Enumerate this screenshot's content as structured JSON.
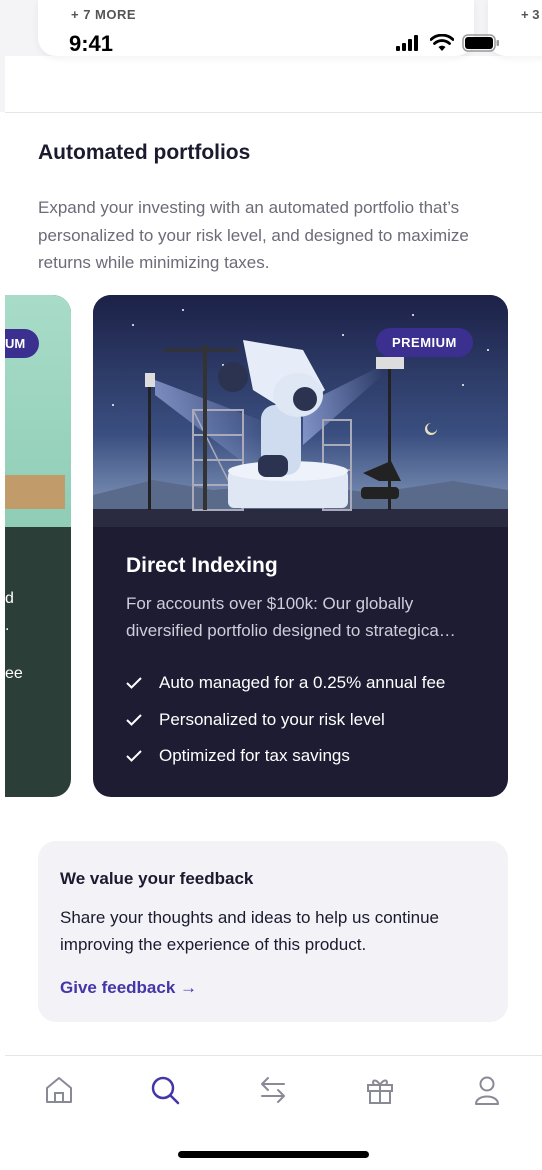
{
  "top_cards": {
    "more_label_1": "+ 7 MORE",
    "more_label_2": "+ 3"
  },
  "status_bar": {
    "time": "9:41"
  },
  "section": {
    "title": "Automated portfolios",
    "description": "Expand your investing with an automated portfolio that’s personalized to your risk level, and designed to maximize returns while minimizing taxes."
  },
  "carousel": {
    "left_card": {
      "badge_partial": "UM",
      "text_fragments": [
        "d",
        ".",
        "ee"
      ]
    },
    "main_card": {
      "badge": "PREMIUM",
      "title": "Direct Indexing",
      "description": "For accounts over $100k: Our globally diversified portfolio designed to strategica…",
      "features": [
        "Auto managed for a 0.25% annual fee",
        "Personalized to your risk level",
        "Optimized for tax savings"
      ]
    }
  },
  "feedback": {
    "title": "We value your feedback",
    "body": "Share your thoughts and ideas to help us continue improving the experience of this product.",
    "link": "Give feedback →"
  },
  "tabbar": {
    "items": [
      "home-icon",
      "search-icon",
      "transfer-icon",
      "gift-icon",
      "profile-icon"
    ],
    "active": "search-icon"
  },
  "colors": {
    "accent": "#4336a6",
    "card_dark": "#1e1c33",
    "badge": "#3b2f8f"
  }
}
